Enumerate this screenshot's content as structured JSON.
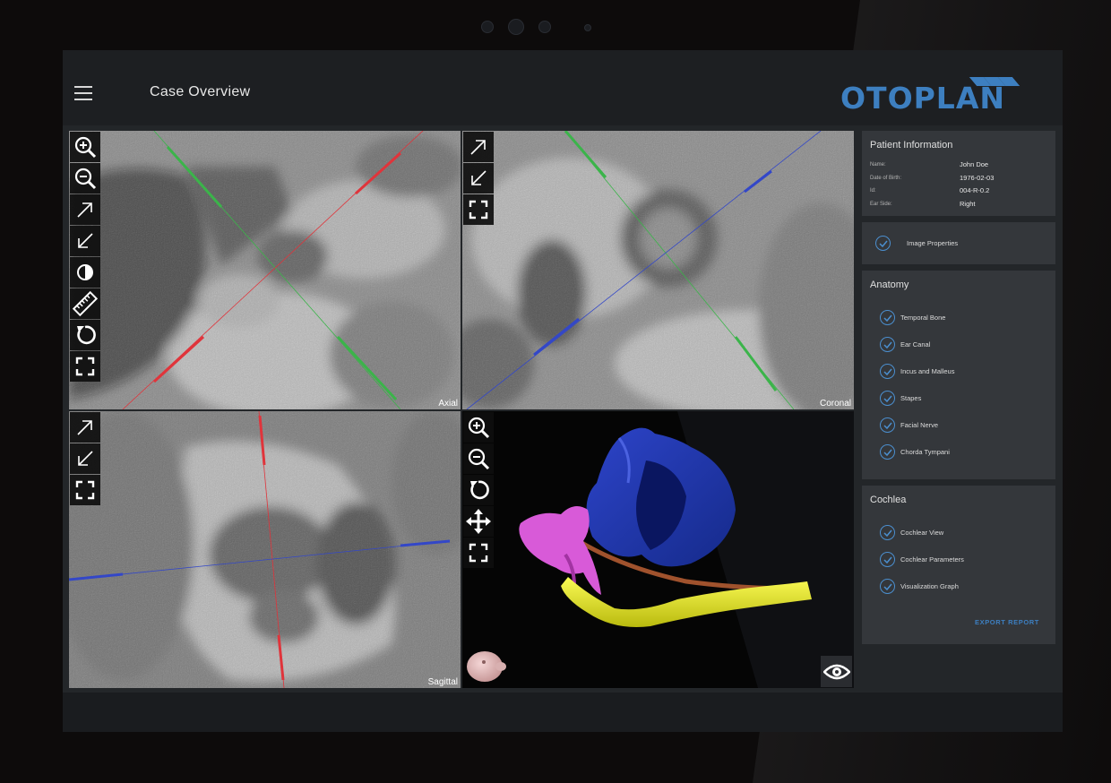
{
  "header": {
    "title": "Case Overview",
    "logo_text": "OTOPLAN"
  },
  "viewports": {
    "axial": {
      "label": "Axial"
    },
    "coronal": {
      "label": "Coronal"
    },
    "sagittal": {
      "label": "Sagittal"
    }
  },
  "patient": {
    "title": "Patient Information",
    "rows": [
      {
        "key": "Name:",
        "value": "John Doe"
      },
      {
        "key": "Date of Birth:",
        "value": "1976-02-03"
      },
      {
        "key": "Id:",
        "value": "004-R-0.2"
      },
      {
        "key": "Ear Side:",
        "value": "Right"
      }
    ]
  },
  "image_properties": {
    "label": "Image Properties"
  },
  "anatomy": {
    "title": "Anatomy",
    "items": [
      "Temporal Bone",
      "Ear Canal",
      "Incus and Malleus",
      "Stapes",
      "Facial Nerve",
      "Chorda Tympani"
    ]
  },
  "cochlea": {
    "title": "Cochlea",
    "items": [
      "Cochlear View",
      "Cochlear Parameters",
      "Visualization Graph"
    ],
    "export_label": "EXPORT REPORT"
  },
  "colors": {
    "accent": "#3d7fc0",
    "crosshair_red": "#e0343b",
    "crosshair_green": "#3bb44a",
    "crosshair_blue": "#3347c8"
  },
  "icons": {
    "viewer_tools": [
      "zoom-in-icon",
      "zoom-out-icon",
      "arrow-up-right-icon",
      "arrow-down-left-icon",
      "contrast-icon",
      "ruler-icon",
      "rotate-icon",
      "fullscreen-icon"
    ],
    "model_tools": [
      "zoom-in-icon",
      "zoom-out-icon",
      "rotate-icon",
      "move-icon",
      "fullscreen-icon"
    ],
    "visibility": "eye-icon"
  }
}
